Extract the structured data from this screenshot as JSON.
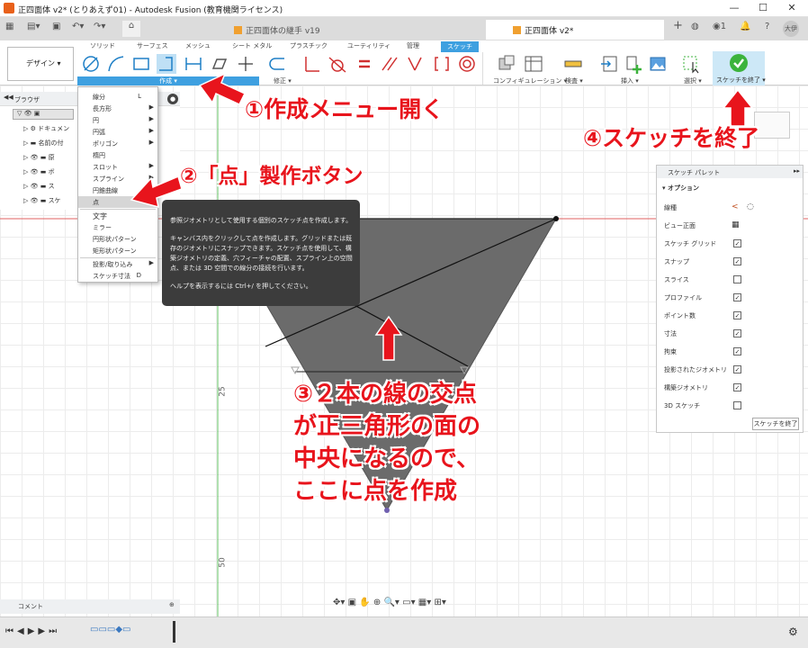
{
  "window": {
    "title": "正四面体 v2* (とりあえず01) - Autodesk Fusion (教育機関ライセンス)",
    "min": "—",
    "max": "☐",
    "close": "✕",
    "user": "大伊"
  },
  "doc_tabs": [
    {
      "label": "正四面体の継手 v19"
    },
    {
      "label": "正四面体 v2*"
    }
  ],
  "qat": {
    "job_count": "1"
  },
  "ribbon": {
    "design_label": "デザイン ▾",
    "tabs": [
      "ソリッド",
      "サーフェス",
      "メッシュ",
      "シート メタル",
      "プラスチック",
      "ユーティリティ",
      "管理",
      "スケッチ"
    ],
    "active_tab": "スケッチ",
    "groups": {
      "create": "作成 ▾",
      "modify": "修正 ▾",
      "config": "コンフィギュレーション ▾",
      "inspect": "検査 ▾",
      "insert": "挿入 ▾",
      "select": "選択 ▾",
      "finish": "スケッチを終了 ▾"
    }
  },
  "browser": {
    "title": "ブラウザ",
    "rows": [
      "ドキュメン",
      "名前の付",
      "原",
      "ボ",
      "ス",
      "スケ"
    ]
  },
  "create_menu": {
    "items": [
      {
        "label": "線分",
        "key": "L",
        "sub": false
      },
      {
        "label": "長方形",
        "key": "",
        "sub": true
      },
      {
        "label": "円",
        "key": "",
        "sub": true
      },
      {
        "label": "円弧",
        "key": "",
        "sub": true
      },
      {
        "label": "ポリゴン",
        "key": "",
        "sub": true
      },
      {
        "label": "楕円",
        "key": "",
        "sub": false
      },
      {
        "label": "スロット",
        "key": "",
        "sub": true
      },
      {
        "label": "スプライン",
        "key": "",
        "sub": true
      },
      {
        "label": "円錐曲線",
        "key": "",
        "sub": false
      },
      {
        "label": "点",
        "key": "",
        "sub": false,
        "selected": true
      },
      {
        "label": "文字",
        "key": "",
        "sub": false
      },
      {
        "label": "ミラー",
        "key": "",
        "sub": false
      },
      {
        "label": "円形状パターン",
        "key": "",
        "sub": false
      },
      {
        "label": "矩形状パターン",
        "key": "",
        "sub": false
      },
      {
        "label": "投影/取り込み",
        "key": "",
        "sub": true
      },
      {
        "label": "スケッチ寸法",
        "key": "D",
        "sub": false
      }
    ]
  },
  "tooltip": {
    "p1": "参照ジオメトリとして使用する個別のスケッチ点を作成します。",
    "p2": "キャンバス内をクリックして点を作成します。グリッドまたは既存のジオメトリにスナップできます。スケッチ点を使用して、構築ジオメトリの定義、穴フィーチャの配置、スプライン上の空間点、または 3D 空間での線分の接続を行います。",
    "p3": "ヘルプを表示するには Ctrl+/ を押してください。"
  },
  "palette": {
    "title": "スケッチ パレット",
    "section": "オプション",
    "rows": [
      {
        "label": "線種",
        "type": "icon"
      },
      {
        "label": "ビュー正面",
        "type": "icon"
      },
      {
        "label": "スケッチ グリッド",
        "checked": true
      },
      {
        "label": "スナップ",
        "checked": true
      },
      {
        "label": "スライス",
        "checked": false
      },
      {
        "label": "プロファイル",
        "checked": true
      },
      {
        "label": "ポイント数",
        "checked": true
      },
      {
        "label": "寸法",
        "checked": true
      },
      {
        "label": "拘束",
        "checked": true
      },
      {
        "label": "投影されたジオメトリ",
        "checked": true
      },
      {
        "label": "構築ジオメトリ",
        "checked": true
      },
      {
        "label": "3D スケッチ",
        "checked": false
      }
    ],
    "finish": "スケッチを終了"
  },
  "ruler": {
    "tick25": "25",
    "tick50": "50"
  },
  "comment": "コメント",
  "annotations": {
    "a1": "①作成メニュー開く",
    "a2": "②「点」製作ボタン",
    "a3": [
      "③２本の線の交点",
      "が正三角形の面の",
      "中央になるので、",
      "ここに点を作成"
    ],
    "a4": "④スケッチを終了"
  },
  "colors": {
    "accent": "#3ea0e0",
    "annotation": "#e8141c",
    "triangle": "#6b6b6b",
    "finish": "#3cb33c"
  }
}
